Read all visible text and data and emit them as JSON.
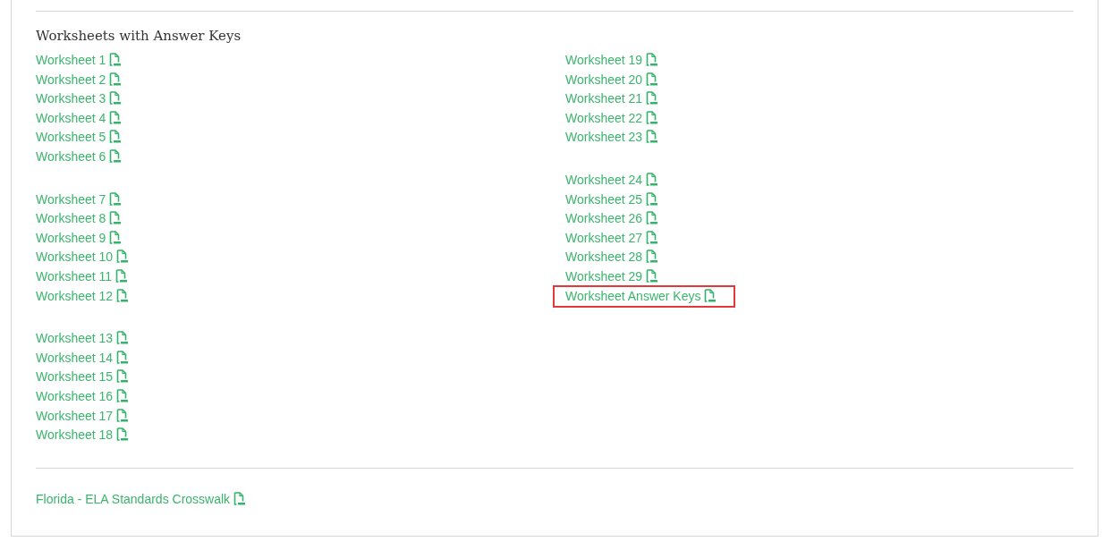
{
  "section": {
    "title": "Worksheets with Answer Keys",
    "columns": [
      {
        "groups": [
          {
            "links": [
              {
                "label": "Worksheet 1",
                "highlighted": false
              },
              {
                "label": "Worksheet 2",
                "highlighted": false
              },
              {
                "label": "Worksheet 3",
                "highlighted": false
              },
              {
                "label": "Worksheet 4",
                "highlighted": false
              },
              {
                "label": "Worksheet 5",
                "highlighted": false
              },
              {
                "label": "Worksheet 6",
                "highlighted": false
              }
            ]
          },
          {
            "links": [
              {
                "label": "Worksheet 7",
                "highlighted": false
              },
              {
                "label": "Worksheet 8",
                "highlighted": false
              },
              {
                "label": "Worksheet 9",
                "highlighted": false
              },
              {
                "label": "Worksheet 10",
                "highlighted": false
              },
              {
                "label": "Worksheet 11",
                "highlighted": false
              },
              {
                "label": "Worksheet 12",
                "highlighted": false
              }
            ]
          },
          {
            "links": [
              {
                "label": "Worksheet 13",
                "highlighted": false
              },
              {
                "label": "Worksheet 14",
                "highlighted": false
              },
              {
                "label": "Worksheet 15",
                "highlighted": false
              },
              {
                "label": "Worksheet 16",
                "highlighted": false
              },
              {
                "label": "Worksheet 17",
                "highlighted": false
              },
              {
                "label": "Worksheet 18",
                "highlighted": false
              }
            ]
          }
        ]
      },
      {
        "groups": [
          {
            "links": [
              {
                "label": "Worksheet 19",
                "highlighted": false
              },
              {
                "label": "Worksheet 20",
                "highlighted": false
              },
              {
                "label": "Worksheet 21",
                "highlighted": false
              },
              {
                "label": "Worksheet 22",
                "highlighted": false
              },
              {
                "label": "Worksheet 23",
                "highlighted": false
              }
            ]
          },
          {
            "links": [
              {
                "label": "Worksheet 24",
                "highlighted": false
              },
              {
                "label": "Worksheet 25",
                "highlighted": false
              },
              {
                "label": "Worksheet 26",
                "highlighted": false
              },
              {
                "label": "Worksheet 27",
                "highlighted": false
              },
              {
                "label": "Worksheet 28",
                "highlighted": false
              },
              {
                "label": "Worksheet 29",
                "highlighted": false
              },
              {
                "label": "Worksheet Answer Keys",
                "highlighted": true
              }
            ]
          }
        ]
      }
    ]
  },
  "footer": {
    "links": [
      {
        "label": "Florida - ELA Standards Crosswalk",
        "highlighted": false
      }
    ]
  }
}
